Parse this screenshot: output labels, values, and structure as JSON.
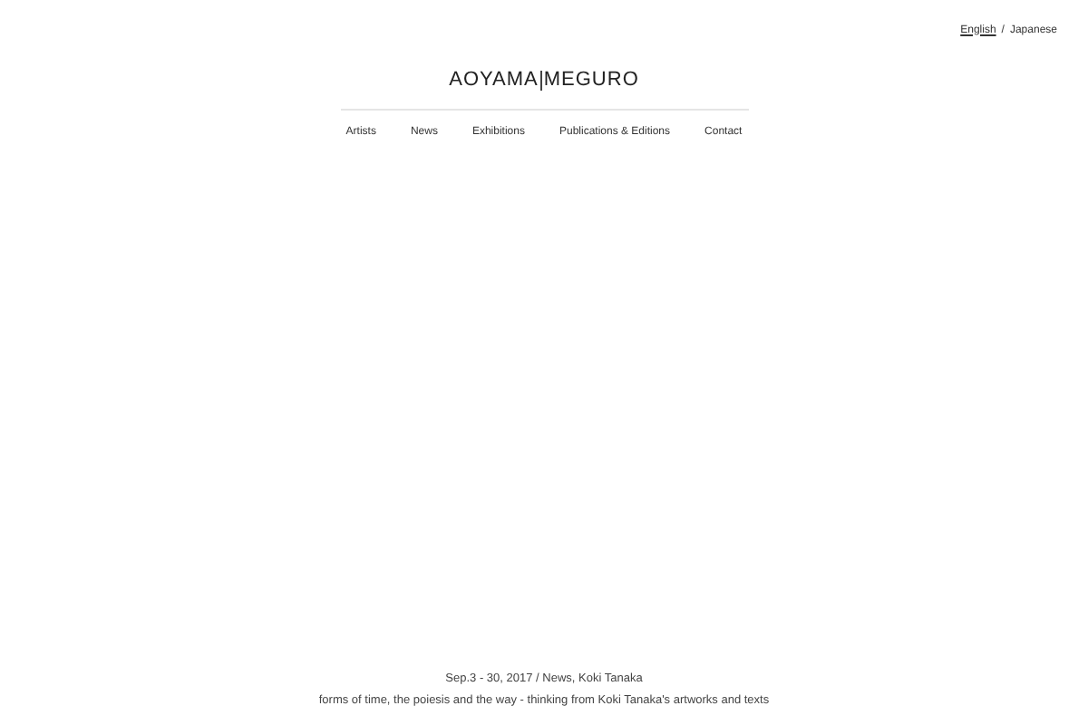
{
  "languages": [
    {
      "label": "English",
      "selected": true
    },
    {
      "label": "Japanese",
      "selected": false
    }
  ],
  "language_separator": "/",
  "logo": {
    "left": "AOYAMA",
    "right": "MEGURO"
  },
  "nav": [
    "Artists",
    "News",
    "Exhibitions",
    "Publications & Editions",
    "Contact"
  ],
  "feature": {
    "meta": "Sep.3 - 30, 2017 / News, Koki Tanaka",
    "title": "forms of time, the poiesis and the way - thinking from Koki Tanaka's artworks and texts"
  }
}
